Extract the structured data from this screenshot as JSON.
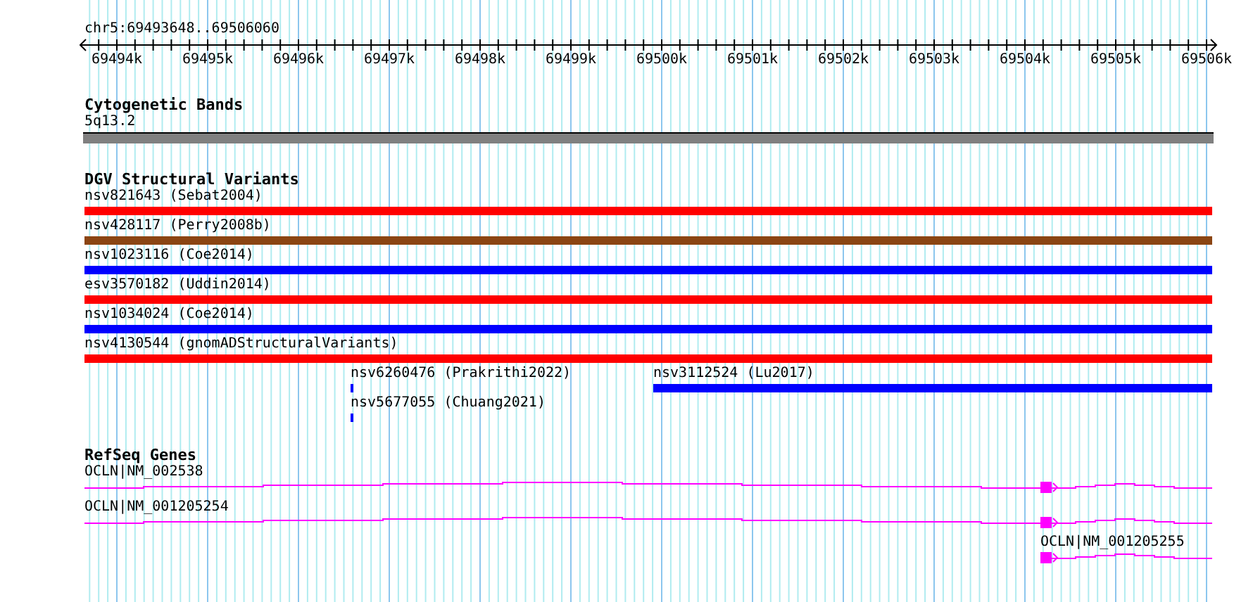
{
  "location": "chr5:69493648..69506060",
  "ruler_ticks": [
    "69494k",
    "69495k",
    "69496k",
    "69497k",
    "69498k",
    "69499k",
    "69500k",
    "69501k",
    "69502k",
    "69503k",
    "69504k",
    "69505k",
    "69506k"
  ],
  "cytobands": {
    "title": "Cytogenetic Bands",
    "band": "5q13.2"
  },
  "variants": {
    "title": "DGV Structural Variants",
    "rows": [
      [
        {
          "label": "nsv821643 (Sebat2004)",
          "kind": "span",
          "color": "#ff0000"
        }
      ],
      [
        {
          "label": "nsv428117 (Perry2008b)",
          "kind": "span",
          "color": "#8b4513"
        }
      ],
      [
        {
          "label": "nsv1023116 (Coe2014)",
          "kind": "span",
          "color": "#0000ff"
        }
      ],
      [
        {
          "label": "esv3570182 (Uddin2014)",
          "kind": "span",
          "color": "#ff0000"
        }
      ],
      [
        {
          "label": "nsv1034024 (Coe2014)",
          "kind": "span",
          "color": "#0000ff"
        }
      ],
      [
        {
          "label": "nsv4130544 (gnomADStructuralVariants)",
          "kind": "span",
          "color": "#ff0000"
        }
      ],
      [
        {
          "label": "nsv6260476 (Prakrithi2022)",
          "kind": "point",
          "color": "#0000ff"
        },
        {
          "label": "nsv3112524 (Lu2017)",
          "kind": "span",
          "color": "#0000ff"
        }
      ],
      [
        {
          "label": "nsv5677055 (Chuang2021)",
          "kind": "point",
          "color": "#0000ff"
        }
      ]
    ]
  },
  "genes": {
    "title": "RefSeq Genes",
    "transcripts": [
      {
        "label": "OCLN|NM_002538",
        "kind": "full"
      },
      {
        "label": "OCLN|NM_001205254",
        "kind": "full"
      },
      {
        "label": "OCLN|NM_001205255",
        "kind": "downstream"
      }
    ]
  }
}
